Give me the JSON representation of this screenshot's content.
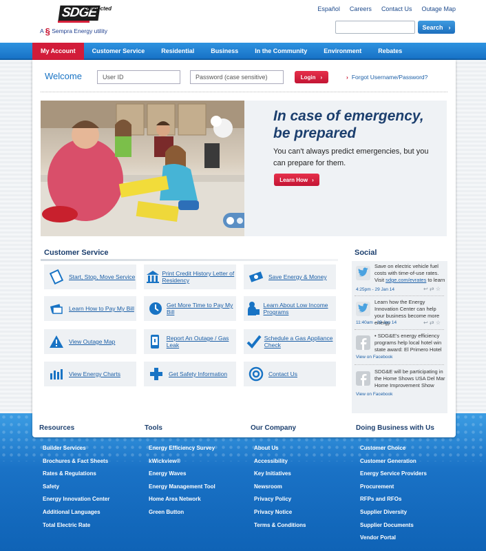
{
  "header": {
    "logo_text": "SDGE",
    "logo_connected": "connected",
    "logo_tagline_prefix": "A",
    "logo_tagline": "Sempra Energy utility",
    "top_links": [
      "Español",
      "Careers",
      "Contact Us",
      "Outage Map"
    ],
    "search_value": "",
    "search_button": "Search"
  },
  "nav": {
    "items": [
      "My Account",
      "Customer Service",
      "Residential",
      "Business",
      "In the Community",
      "Environment",
      "Rebates"
    ]
  },
  "login": {
    "welcome": "Welcome",
    "user_id_placeholder": "User ID",
    "password_placeholder": "Password (case sensitive)",
    "login_button": "Login",
    "forgot": "Forgot Username/Password?"
  },
  "hero": {
    "title_line1": "In case of emergency,",
    "title_line2": "be prepared",
    "text": "You can't always predict emergencies, but you can prepare for them.",
    "button": "Learn How",
    "slides": 4,
    "active_slide": 1
  },
  "customer_service": {
    "title": "Customer Service",
    "tiles": [
      {
        "label": "Start, Stop, Move Service",
        "icon": "document-icon"
      },
      {
        "label": "Print Credit History Letter of Residency",
        "icon": "building-icon"
      },
      {
        "label": "Save Energy & Money",
        "icon": "money-icon"
      },
      {
        "label": "Learn How to Pay My Bill",
        "icon": "bill-icon"
      },
      {
        "label": "Get More Time to Pay My Bill",
        "icon": "clock-icon"
      },
      {
        "label": "Learn About Low Income Programs",
        "icon": "person-icon"
      },
      {
        "label": "View Outage Map",
        "icon": "warning-icon"
      },
      {
        "label": "Report An Outage / Gas Leak",
        "icon": "phone-icon"
      },
      {
        "label": "Schedule a Gas Appliance Check",
        "icon": "checkmark-icon"
      },
      {
        "label": "View Energy Charts",
        "icon": "bar-chart-icon"
      },
      {
        "label": "Get Safety Information",
        "icon": "plus-icon"
      },
      {
        "label": "Contact Us",
        "icon": "at-sign-icon"
      }
    ]
  },
  "social": {
    "title": "Social",
    "items": [
      {
        "type": "twitter",
        "text_before": "Save on electric vehicle fuel costs with time-of-use rates. Visit ",
        "link": "sdge.com/evrates",
        "text_after": " to learn",
        "meta": "4:25pm - 29 Jan 14"
      },
      {
        "type": "twitter",
        "text_before": "Learn how the Energy Innovation Center can help your business become more energy",
        "link": "",
        "text_after": "",
        "meta": "11:40am - 29 Jan 14"
      },
      {
        "type": "facebook",
        "text_before": "• SDG&E's energy efficiency programs help local hotel win state award: El Primero Hotel",
        "link": "",
        "text_after": "",
        "meta": "View on Facebook"
      },
      {
        "type": "facebook",
        "text_before": "SDG&E will be participating in the Home Shows USA Del Mar Home Improvement Show",
        "link": "",
        "text_after": "",
        "meta": "View on Facebook"
      }
    ]
  },
  "footer": {
    "columns": [
      {
        "title": "Resources",
        "links": [
          "Builder Services",
          "Brochures & Fact Sheets",
          "Rates & Regulations",
          "Safety",
          "Energy Innovation Center",
          "Additional Languages",
          "Total Electric Rate"
        ]
      },
      {
        "title": "Tools",
        "links": [
          "Energy Efficiency Survey",
          "kWickview®",
          "Energy Waves",
          "Energy Management Tool",
          "Home Area Network",
          "Green Button"
        ]
      },
      {
        "title": "Our Company",
        "links": [
          "About Us",
          "Accessibility",
          "Key Initiatives",
          "Newsroom",
          "Privacy Policy",
          "Privacy Notice",
          "Terms & Conditions"
        ]
      },
      {
        "title": "Doing Business with Us",
        "links": [
          "Customer Choice",
          "Customer Generation",
          "Energy Service Providers",
          "Procurement",
          "RFPs and RFOs",
          "Supplier Diversity",
          "Supplier Documents",
          "Vendor Portal"
        ]
      }
    ]
  },
  "colors": {
    "brand_blue": "#1873c4",
    "brand_red": "#d21c3a",
    "navy": "#1c3f6e"
  }
}
